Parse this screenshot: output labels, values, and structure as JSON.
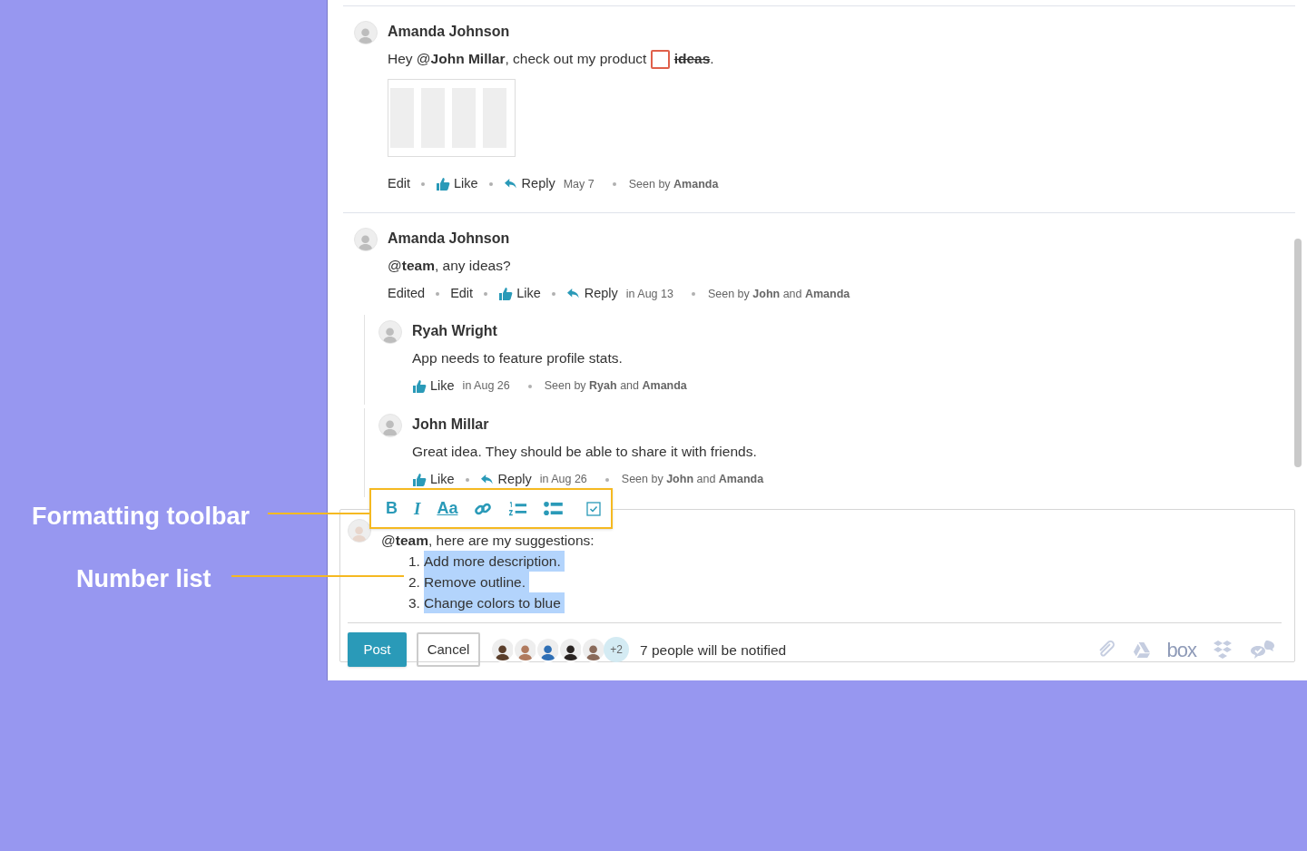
{
  "annotations": [
    {
      "kind": "toolbar",
      "label": "Formatting toolbar"
    },
    {
      "kind": "list",
      "label": "Number list"
    }
  ],
  "comments": [
    {
      "author": "Amanda Johnson",
      "message": [
        {
          "kind": "text",
          "text": "Hey @"
        },
        {
          "kind": "bold",
          "text": "John Millar"
        },
        {
          "kind": "text",
          "text": ", check out my product "
        },
        {
          "kind": "checkbox",
          "checked": false
        },
        {
          "kind": "strike",
          "text": "ideas"
        },
        {
          "kind": "text",
          "text": "."
        }
      ],
      "attachment": true,
      "actions": [
        {
          "kind": "edit",
          "label": "Edit"
        },
        {
          "kind": "like",
          "label": "Like"
        },
        {
          "kind": "reply",
          "label": "Reply"
        }
      ],
      "time": "May 7",
      "seen": "Seen by **Amanda**"
    },
    {
      "author": "Amanda Johnson",
      "message": [
        {
          "kind": "text",
          "text": "@"
        },
        {
          "kind": "bold",
          "text": "team"
        },
        {
          "kind": "text",
          "text": ", any ideas?"
        }
      ],
      "actions": [
        {
          "kind": "edited",
          "label": "Edited"
        },
        {
          "kind": "edit",
          "label": "Edit"
        },
        {
          "kind": "like",
          "label": "Like"
        },
        {
          "kind": "reply",
          "label": "Reply"
        }
      ],
      "time": "in Aug 13",
      "seen": "Seen by **John** and **Amanda**",
      "replies": [
        {
          "author": "Ryah Wright",
          "message": [
            {
              "kind": "text",
              "text": "App needs to feature profile stats."
            }
          ],
          "actions": [
            {
              "kind": "like",
              "label": "Like"
            }
          ],
          "time": "in Aug 26",
          "seen": "Seen by **Ryah** and **Amanda**"
        },
        {
          "author": "John Millar",
          "message": [
            {
              "kind": "text",
              "text": "Great idea. They should be able to share it with friends."
            }
          ],
          "actions": [
            {
              "kind": "like",
              "label": "Like"
            },
            {
              "kind": "reply",
              "label": "Reply"
            }
          ],
          "time": "in Aug 26",
          "seen": "Seen by **John** and **Amanda**"
        }
      ]
    }
  ],
  "composer": {
    "toolbar": [
      {
        "kind": "bold",
        "label": "B"
      },
      {
        "kind": "italic",
        "label": "I"
      },
      {
        "kind": "size",
        "label": "Aa"
      },
      {
        "kind": "link"
      },
      {
        "kind": "numbered"
      },
      {
        "kind": "bullets"
      },
      {
        "kind": "checkbox"
      }
    ],
    "intro": "@**team**, here are my suggestions:",
    "list": [
      {
        "number": "1.",
        "text": "Add more description.",
        "highlighted": true
      },
      {
        "number": "2.",
        "text": "Remove outline.",
        "highlighted": true
      },
      {
        "number": "3.",
        "text": "Change colors to blue",
        "highlighted": true
      }
    ],
    "buttons": [
      {
        "kind": "primary",
        "label": "Post"
      },
      {
        "kind": "secondary",
        "label": "Cancel"
      }
    ],
    "notify_avatars": [
      {
        "color": "#5a3e2b"
      },
      {
        "color": "#b07a5e"
      },
      {
        "color": "#2f6fb5"
      },
      {
        "color": "#2a2422"
      },
      {
        "color": "#8a6a5a"
      }
    ],
    "more_count": "+2",
    "notify_text": "7 people will be notified",
    "integrations": [
      {
        "kind": "clip"
      },
      {
        "kind": "drive"
      },
      {
        "kind": "box",
        "label": "box"
      },
      {
        "kind": "dropbox"
      },
      {
        "kind": "chat"
      }
    ]
  }
}
